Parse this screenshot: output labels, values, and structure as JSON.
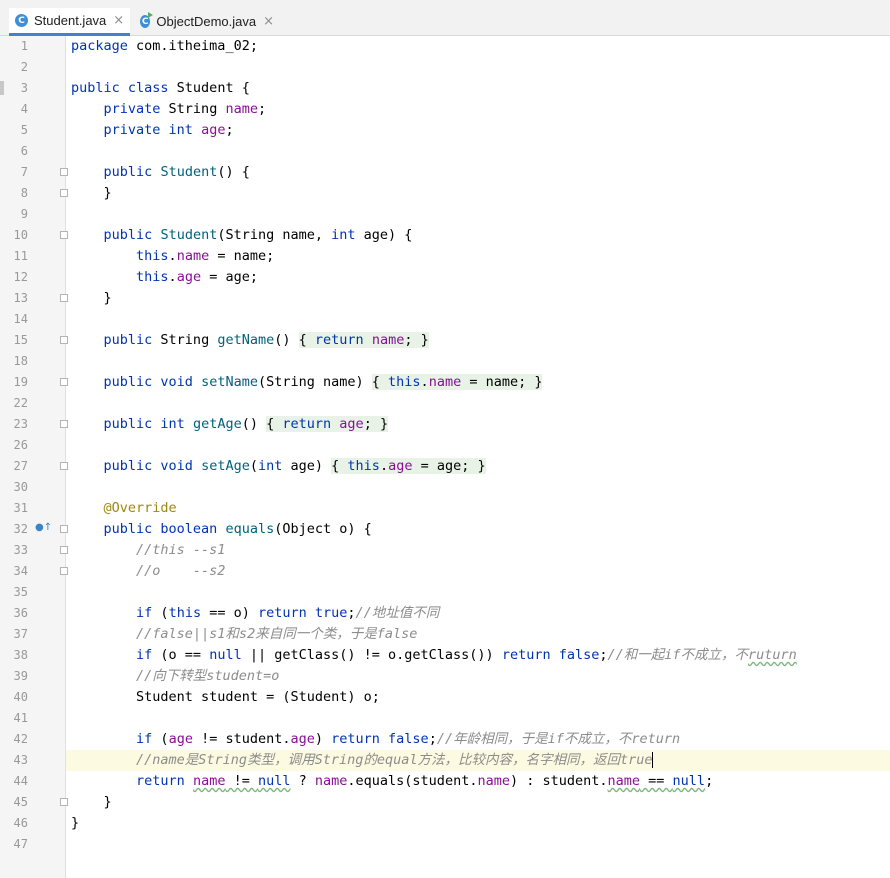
{
  "tabs": [
    {
      "label": "Student.java",
      "icon": "class-icon",
      "active": true
    },
    {
      "label": "ObjectDemo.java",
      "icon": "runnable-class-icon",
      "active": false
    }
  ],
  "gutter": {
    "line_numbers": [
      "1",
      "2",
      "3",
      "4",
      "5",
      "6",
      "7",
      "8",
      "9",
      "10",
      "11",
      "12",
      "13",
      "14",
      "15",
      "18",
      "19",
      "22",
      "23",
      "26",
      "27",
      "30",
      "31",
      "32",
      "33",
      "34",
      "35",
      "36",
      "37",
      "38",
      "39",
      "40",
      "41",
      "42",
      "43",
      "44",
      "45",
      "46",
      "47"
    ]
  },
  "code": {
    "l1a": "package",
    "l1b": " com.itheima_02;",
    "l3a": "public class",
    "l3b": " Student {",
    "l4a": "private",
    "l4b": " String ",
    "l4c": "name",
    "l4d": ";",
    "l5a": "private int",
    "l5b": " ",
    "l5c": "age",
    "l5d": ";",
    "l7a": "public",
    "l7b": " ",
    "l7c": "Student",
    "l7d": "() {",
    "l8": "}",
    "l10a": "public",
    "l10b": " ",
    "l10c": "Student",
    "l10d": "(String name, ",
    "l10e": "int",
    "l10f": " age) {",
    "l11a": "this",
    "l11b": ".",
    "l11c": "name",
    "l11d": " = name;",
    "l12a": "this",
    "l12b": ".",
    "l12c": "age",
    "l12d": " = age;",
    "l13": "}",
    "l15a": "public",
    "l15b": " String ",
    "l15c": "getName",
    "l15d": "() ",
    "l15e": "{ ",
    "l15f": "return",
    "l15g": " ",
    "l15h": "name",
    "l15i": "; }",
    "l19a": "public void",
    "l19b": " ",
    "l19c": "setName",
    "l19d": "(String name) ",
    "l19e": "{ ",
    "l19f": "this",
    "l19g": ".",
    "l19h": "name",
    "l19i": " = name; }",
    "l23a": "public int",
    "l23b": " ",
    "l23c": "getAge",
    "l23d": "() ",
    "l23e": "{ ",
    "l23f": "return",
    "l23g": " ",
    "l23h": "age",
    "l23i": "; }",
    "l27a": "public void",
    "l27b": " ",
    "l27c": "setAge",
    "l27d": "(",
    "l27e": "int",
    "l27f": " age) ",
    "l27g": "{ ",
    "l27h": "this",
    "l27i": ".",
    "l27j": "age",
    "l27k": " = age; }",
    "l31": "@Override",
    "l32a": "public boolean",
    "l32b": " ",
    "l32c": "equals",
    "l32d": "(Object o) {",
    "l33": "//this --s1",
    "l34": "//o    --s2",
    "l36a": "if",
    "l36b": " (",
    "l36c": "this",
    "l36d": " == o) ",
    "l36e": "return true",
    "l36f": ";",
    "l36g": "//地址值不同",
    "l37": "//false||s1和s2来自同一个类，于是false",
    "l38a": "if",
    "l38b": " (o == ",
    "l38c": "null",
    "l38d": " || getClass() != o.getClass()) ",
    "l38e": "return false",
    "l38f": ";",
    "l38g": "//和一起if不成立，不",
    "l38h": "ruturn",
    "l39": "//向下转型student=o",
    "l40": "Student student = (Student) o;",
    "l42a": "if",
    "l42b": " (",
    "l42c": "age",
    "l42d": " != student.",
    "l42e": "age",
    "l42f": ") ",
    "l42g": "return false",
    "l42h": ";",
    "l42i": "//年龄相同，于是if不成立，不return",
    "l43": "//name是String类型，调用String的equal方法，比较内容，名字相同，返回true",
    "l44a": "return",
    "l44b": " ",
    "l44c": "name",
    "l44d": " != ",
    "l44e": "null",
    "l44f": " ? ",
    "l44g": "name",
    "l44h": ".equals(student.",
    "l44i": "name",
    "l44j": ") : student.",
    "l44k": "name",
    "l44l": " == ",
    "l44m": "null",
    "l44n": ";",
    "l45": "}",
    "l46": "}"
  },
  "colors": {
    "keyword": "#0033b3",
    "field": "#871094",
    "method": "#00627a",
    "annotation": "#9e880d",
    "comment": "#8c8c8c",
    "current_line": "#fcfae1"
  }
}
